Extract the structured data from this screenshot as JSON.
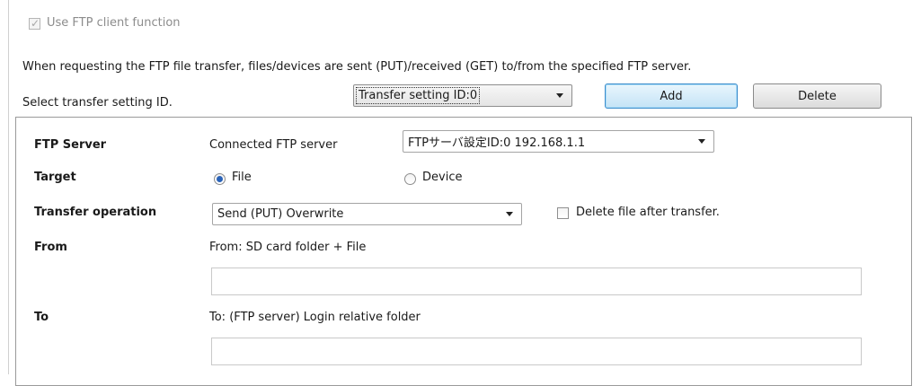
{
  "use_ftp_client": {
    "label": "Use FTP client function",
    "checked": true,
    "enabled": false
  },
  "description": "When requesting the FTP file transfer, files/devices are sent (PUT)/received (GET) to/from the specified FTP server.",
  "transfer_select": {
    "label": "Select transfer setting ID.",
    "selected": "Transfer setting ID:0",
    "add_label": "Add",
    "delete_label": "Delete"
  },
  "ftp_server": {
    "label": "FTP Server",
    "connected_label": "Connected FTP server",
    "selected": "FTPサーバ設定ID:0 192.168.1.1"
  },
  "target": {
    "label": "Target",
    "options": [
      "File",
      "Device"
    ],
    "selected": "File"
  },
  "transfer_operation": {
    "label": "Transfer operation",
    "selected": "Send (PUT) Overwrite",
    "delete_after_label": "Delete file after transfer.",
    "delete_after_checked": false
  },
  "from": {
    "label": "From",
    "description": "From: SD card folder + File",
    "value": ""
  },
  "to": {
    "label": "To",
    "description": "To: (FTP server) Login relative folder",
    "value": ""
  }
}
